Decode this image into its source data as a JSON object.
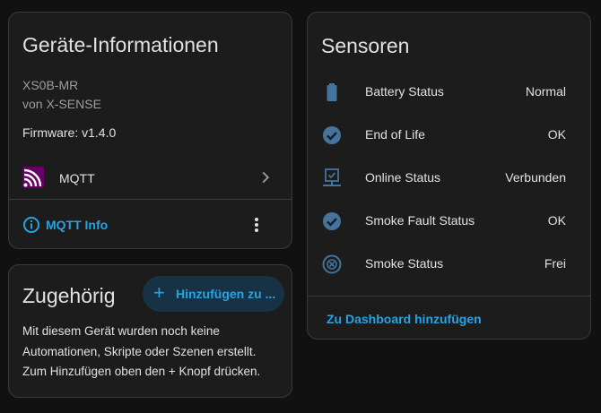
{
  "device_info": {
    "title": "Geräte-Informationen",
    "model": "XS0B-MR",
    "manufacturer": "von X-SENSE",
    "firmware": "Firmware: v1.4.0",
    "integration": {
      "name": "MQTT",
      "icon": "mqtt-logo",
      "accent_color": "#660066"
    },
    "info_link": "MQTT Info"
  },
  "related": {
    "title": "Zugehörig",
    "add_button": "Hinzufügen zu ...",
    "description_lines": [
      "Mit diesem Gerät wurden noch keine",
      "Automationen, Skripte oder Szenen erstellt.",
      "Zum Hinzufügen oben den + Knopf drücken."
    ]
  },
  "sensors": {
    "title": "Sensoren",
    "items": [
      {
        "label": "Battery Status",
        "value": "Normal",
        "icon": "battery-icon"
      },
      {
        "label": "End of Life",
        "value": "OK",
        "icon": "check-circle-icon"
      },
      {
        "label": "Online Status",
        "value": "Verbunden",
        "icon": "lan-connect-icon"
      },
      {
        "label": "Smoke Fault Status",
        "value": "OK",
        "icon": "check-circle-icon"
      },
      {
        "label": "Smoke Status",
        "value": "Frei",
        "icon": "smoke-detector-icon"
      }
    ],
    "add_dashboard": "Zu Dashboard hinzufügen"
  },
  "colors": {
    "background": "#111111",
    "card": "#1c1c1c",
    "accent": "#27a3e3",
    "icon": "#44739e",
    "text": "#e1e1e1",
    "secondary_text": "#9e9e9e"
  }
}
